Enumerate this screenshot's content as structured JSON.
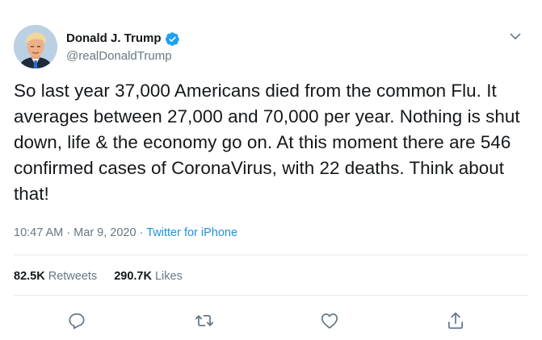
{
  "author": {
    "display_name": "Donald J. Trump",
    "handle": "@realDonaldTrump",
    "verified": true,
    "verified_color": "#1da1f2"
  },
  "tweet": {
    "text": "So last year 37,000 Americans died from the common Flu. It averages between 27,000 and 70,000 per year. Nothing is shut down, life & the economy go on. At this moment there are 546 confirmed cases of CoronaVirus, with 22 deaths. Think about that!",
    "time": "10:47 AM",
    "separator": "·",
    "date": "Mar 9, 2020",
    "source": "Twitter for iPhone"
  },
  "stats": {
    "retweets_count": "82.5K",
    "retweets_label": "Retweets",
    "likes_count": "290.7K",
    "likes_label": "Likes"
  },
  "actions": {
    "icons": [
      "reply-icon",
      "retweet-icon",
      "like-icon",
      "share-icon"
    ],
    "icon_color": "#657786"
  },
  "colors": {
    "text": "#14171a",
    "secondary": "#657786",
    "link": "#1b95e0",
    "divider": "#e6ecf0"
  }
}
